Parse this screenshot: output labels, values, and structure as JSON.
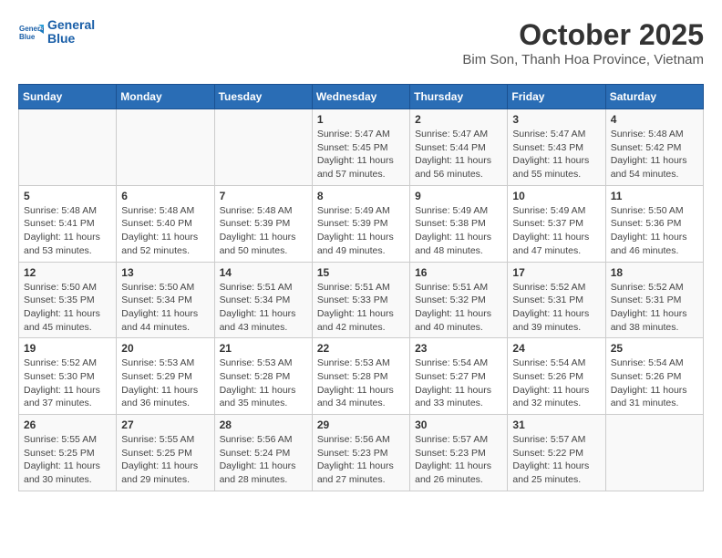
{
  "header": {
    "logo_line1": "General",
    "logo_line2": "Blue",
    "title": "October 2025",
    "subtitle": "Bim Son, Thanh Hoa Province, Vietnam"
  },
  "weekdays": [
    "Sunday",
    "Monday",
    "Tuesday",
    "Wednesday",
    "Thursday",
    "Friday",
    "Saturday"
  ],
  "weeks": [
    [
      {
        "day": "",
        "info": ""
      },
      {
        "day": "",
        "info": ""
      },
      {
        "day": "",
        "info": ""
      },
      {
        "day": "1",
        "info": "Sunrise: 5:47 AM\nSunset: 5:45 PM\nDaylight: 11 hours and 57 minutes."
      },
      {
        "day": "2",
        "info": "Sunrise: 5:47 AM\nSunset: 5:44 PM\nDaylight: 11 hours and 56 minutes."
      },
      {
        "day": "3",
        "info": "Sunrise: 5:47 AM\nSunset: 5:43 PM\nDaylight: 11 hours and 55 minutes."
      },
      {
        "day": "4",
        "info": "Sunrise: 5:48 AM\nSunset: 5:42 PM\nDaylight: 11 hours and 54 minutes."
      }
    ],
    [
      {
        "day": "5",
        "info": "Sunrise: 5:48 AM\nSunset: 5:41 PM\nDaylight: 11 hours and 53 minutes."
      },
      {
        "day": "6",
        "info": "Sunrise: 5:48 AM\nSunset: 5:40 PM\nDaylight: 11 hours and 52 minutes."
      },
      {
        "day": "7",
        "info": "Sunrise: 5:48 AM\nSunset: 5:39 PM\nDaylight: 11 hours and 50 minutes."
      },
      {
        "day": "8",
        "info": "Sunrise: 5:49 AM\nSunset: 5:39 PM\nDaylight: 11 hours and 49 minutes."
      },
      {
        "day": "9",
        "info": "Sunrise: 5:49 AM\nSunset: 5:38 PM\nDaylight: 11 hours and 48 minutes."
      },
      {
        "day": "10",
        "info": "Sunrise: 5:49 AM\nSunset: 5:37 PM\nDaylight: 11 hours and 47 minutes."
      },
      {
        "day": "11",
        "info": "Sunrise: 5:50 AM\nSunset: 5:36 PM\nDaylight: 11 hours and 46 minutes."
      }
    ],
    [
      {
        "day": "12",
        "info": "Sunrise: 5:50 AM\nSunset: 5:35 PM\nDaylight: 11 hours and 45 minutes."
      },
      {
        "day": "13",
        "info": "Sunrise: 5:50 AM\nSunset: 5:34 PM\nDaylight: 11 hours and 44 minutes."
      },
      {
        "day": "14",
        "info": "Sunrise: 5:51 AM\nSunset: 5:34 PM\nDaylight: 11 hours and 43 minutes."
      },
      {
        "day": "15",
        "info": "Sunrise: 5:51 AM\nSunset: 5:33 PM\nDaylight: 11 hours and 42 minutes."
      },
      {
        "day": "16",
        "info": "Sunrise: 5:51 AM\nSunset: 5:32 PM\nDaylight: 11 hours and 40 minutes."
      },
      {
        "day": "17",
        "info": "Sunrise: 5:52 AM\nSunset: 5:31 PM\nDaylight: 11 hours and 39 minutes."
      },
      {
        "day": "18",
        "info": "Sunrise: 5:52 AM\nSunset: 5:31 PM\nDaylight: 11 hours and 38 minutes."
      }
    ],
    [
      {
        "day": "19",
        "info": "Sunrise: 5:52 AM\nSunset: 5:30 PM\nDaylight: 11 hours and 37 minutes."
      },
      {
        "day": "20",
        "info": "Sunrise: 5:53 AM\nSunset: 5:29 PM\nDaylight: 11 hours and 36 minutes."
      },
      {
        "day": "21",
        "info": "Sunrise: 5:53 AM\nSunset: 5:28 PM\nDaylight: 11 hours and 35 minutes."
      },
      {
        "day": "22",
        "info": "Sunrise: 5:53 AM\nSunset: 5:28 PM\nDaylight: 11 hours and 34 minutes."
      },
      {
        "day": "23",
        "info": "Sunrise: 5:54 AM\nSunset: 5:27 PM\nDaylight: 11 hours and 33 minutes."
      },
      {
        "day": "24",
        "info": "Sunrise: 5:54 AM\nSunset: 5:26 PM\nDaylight: 11 hours and 32 minutes."
      },
      {
        "day": "25",
        "info": "Sunrise: 5:54 AM\nSunset: 5:26 PM\nDaylight: 11 hours and 31 minutes."
      }
    ],
    [
      {
        "day": "26",
        "info": "Sunrise: 5:55 AM\nSunset: 5:25 PM\nDaylight: 11 hours and 30 minutes."
      },
      {
        "day": "27",
        "info": "Sunrise: 5:55 AM\nSunset: 5:25 PM\nDaylight: 11 hours and 29 minutes."
      },
      {
        "day": "28",
        "info": "Sunrise: 5:56 AM\nSunset: 5:24 PM\nDaylight: 11 hours and 28 minutes."
      },
      {
        "day": "29",
        "info": "Sunrise: 5:56 AM\nSunset: 5:23 PM\nDaylight: 11 hours and 27 minutes."
      },
      {
        "day": "30",
        "info": "Sunrise: 5:57 AM\nSunset: 5:23 PM\nDaylight: 11 hours and 26 minutes."
      },
      {
        "day": "31",
        "info": "Sunrise: 5:57 AM\nSunset: 5:22 PM\nDaylight: 11 hours and 25 minutes."
      },
      {
        "day": "",
        "info": ""
      }
    ]
  ]
}
